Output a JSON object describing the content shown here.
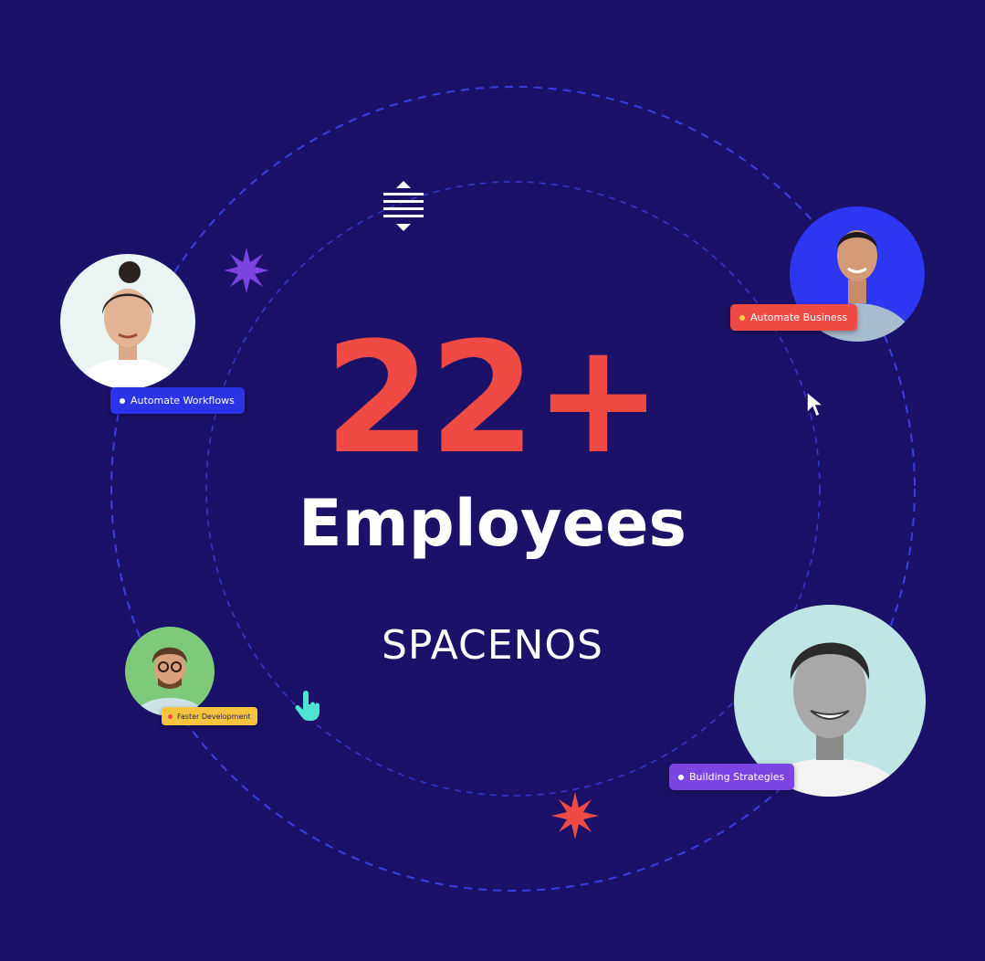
{
  "colors": {
    "background": "#1b1168",
    "accent_red": "#ef4a43",
    "white": "#ffffff",
    "dashed_ring": "#3a3fe0"
  },
  "stat": {
    "value": "22+"
  },
  "headline": "Employees",
  "brand": "SPACENOS",
  "profiles": [
    {
      "badge": "Automate Workflows",
      "badge_color": "#2b33e6",
      "dot_color": "#ffffff"
    },
    {
      "badge": "Automate Business",
      "badge_color": "#ef4a43",
      "dot_color": "#ffd24a"
    },
    {
      "badge": "Faster Development",
      "badge_color": "#f7c53d",
      "dot_color": "#ef4a43"
    },
    {
      "badge": "Building Strategies",
      "badge_color": "#7d44e4",
      "dot_color": "#ffffff"
    }
  ],
  "icons": [
    "expand-vertical-icon",
    "sparkle-star-icon",
    "mouse-cursor-icon",
    "hand-pointer-icon"
  ]
}
